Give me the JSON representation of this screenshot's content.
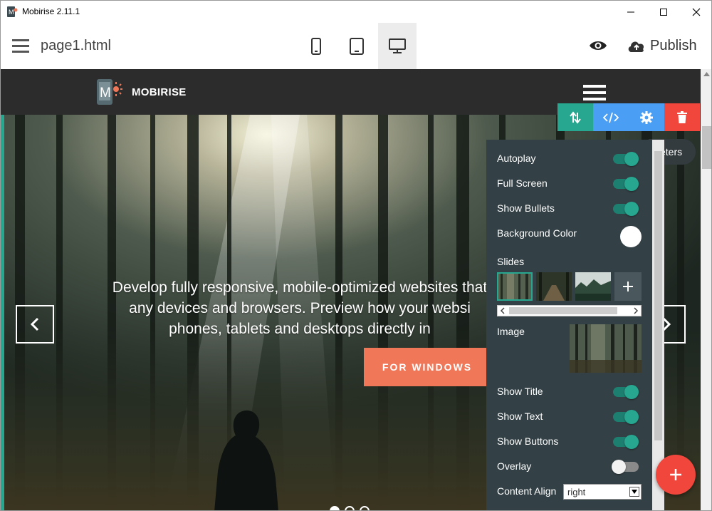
{
  "window": {
    "title": "Mobirise 2.11.1",
    "controls": [
      "minimize-icon",
      "maximize-icon",
      "close-icon"
    ]
  },
  "toolbar": {
    "page_name": "page1.html",
    "devices": [
      {
        "name": "mobile",
        "icon": "phone-icon",
        "active": false
      },
      {
        "name": "tablet",
        "icon": "tablet-icon",
        "active": false
      },
      {
        "name": "desktop",
        "icon": "desktop-icon",
        "active": true
      }
    ],
    "preview_icon": "eye-icon",
    "publish_label": "Publish",
    "publish_icon": "cloud-upload-icon"
  },
  "site": {
    "brand": "MOBIRISE",
    "hero_text": "Develop fully responsive, mobile-optimized websites that any devices and browsers. Preview how your websi phones, tablets and desktops directly in",
    "cta_label": "FOR WINDOWS",
    "bullet_count": 3,
    "active_bullet": 0
  },
  "block_tools": {
    "tooltip": "eters",
    "colors": {
      "move": "#27a690",
      "code": "#4a9ff5",
      "settings": "#4a9ff5",
      "delete": "#f0463c"
    }
  },
  "settings": {
    "autoplay": {
      "label": "Autoplay",
      "on": true
    },
    "full_screen": {
      "label": "Full Screen",
      "on": true
    },
    "show_bullets": {
      "label": "Show Bullets",
      "on": true
    },
    "background_color": {
      "label": "Background Color",
      "value": "#ffffff"
    },
    "slides": {
      "label": "Slides",
      "count": 3,
      "selected": 0
    },
    "image": {
      "label": "Image"
    },
    "show_title": {
      "label": "Show Title",
      "on": true
    },
    "show_text": {
      "label": "Show Text",
      "on": true
    },
    "show_buttons": {
      "label": "Show Buttons",
      "on": true
    },
    "overlay": {
      "label": "Overlay",
      "on": false
    },
    "content_align": {
      "label": "Content Align",
      "value": "right"
    }
  },
  "accent_color": "#27a690"
}
